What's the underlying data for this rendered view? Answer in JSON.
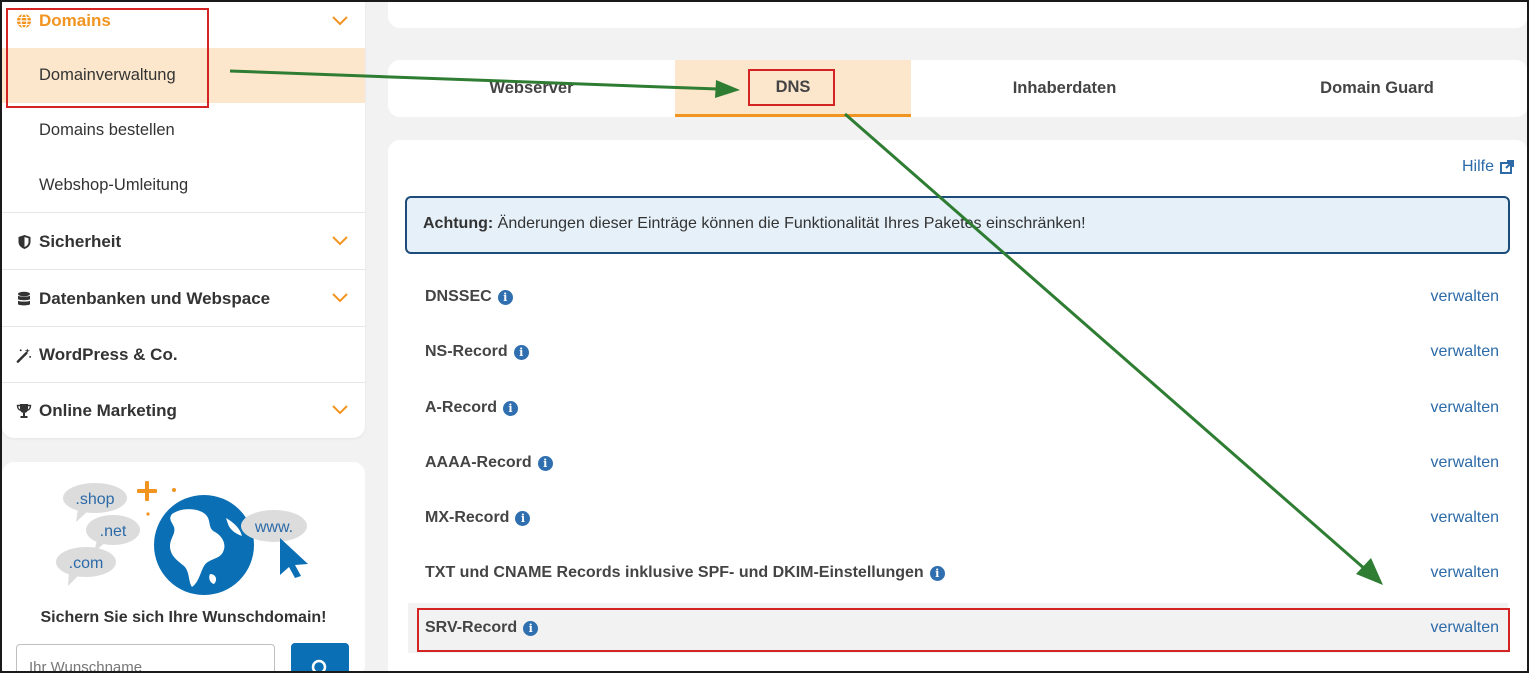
{
  "sidebar": {
    "domains": {
      "label": "Domains",
      "icon": "globe-icon"
    },
    "sub_items": [
      {
        "label": "Domainverwaltung",
        "active": true
      },
      {
        "label": "Domains bestellen",
        "active": false
      },
      {
        "label": "Webshop-Umleitung",
        "active": false
      }
    ],
    "sections": [
      {
        "label": "Sicherheit",
        "icon": "shield-icon"
      },
      {
        "label": "Datenbanken und Webspace",
        "icon": "database-icon"
      },
      {
        "label": "WordPress & Co.",
        "icon": "magic-wand-icon"
      },
      {
        "label": "Online Marketing",
        "icon": "trophy-icon"
      }
    ]
  },
  "promo": {
    "bubbles": {
      "shop": ".shop",
      "net": ".net",
      "com": ".com",
      "www": "www."
    },
    "title": "Sichern Sie sich Ihre Wunschdomain!",
    "input_placeholder": "Ihr Wunschname"
  },
  "tabs": [
    {
      "label": "Webserver",
      "active": false
    },
    {
      "label": "DNS",
      "active": true
    },
    {
      "label": "Inhaberdaten",
      "active": false
    },
    {
      "label": "Domain Guard",
      "active": false
    }
  ],
  "main": {
    "help_label": "Hilfe",
    "alert_bold": "Achtung:",
    "alert_text": " Änderungen dieser Einträge können die Funktionalität Ihres Paketes einschränken!",
    "records": [
      {
        "name": "DNSSEC",
        "action": "verwalten"
      },
      {
        "name": "NS-Record",
        "action": "verwalten"
      },
      {
        "name": "A-Record",
        "action": "verwalten"
      },
      {
        "name": "AAAA-Record",
        "action": "verwalten"
      },
      {
        "name": "MX-Record",
        "action": "verwalten"
      },
      {
        "name": "TXT und CNAME Records inklusive SPF- und DKIM-Einstellungen",
        "action": "verwalten"
      },
      {
        "name": "SRV-Record",
        "action": "verwalten",
        "highlighted": true
      }
    ]
  },
  "colors": {
    "accent_orange": "#f29420",
    "active_bg": "#fde7cc",
    "link_blue": "#2c6aa8",
    "annotation_red": "#d32323",
    "arrow_green": "#2e7d32"
  }
}
